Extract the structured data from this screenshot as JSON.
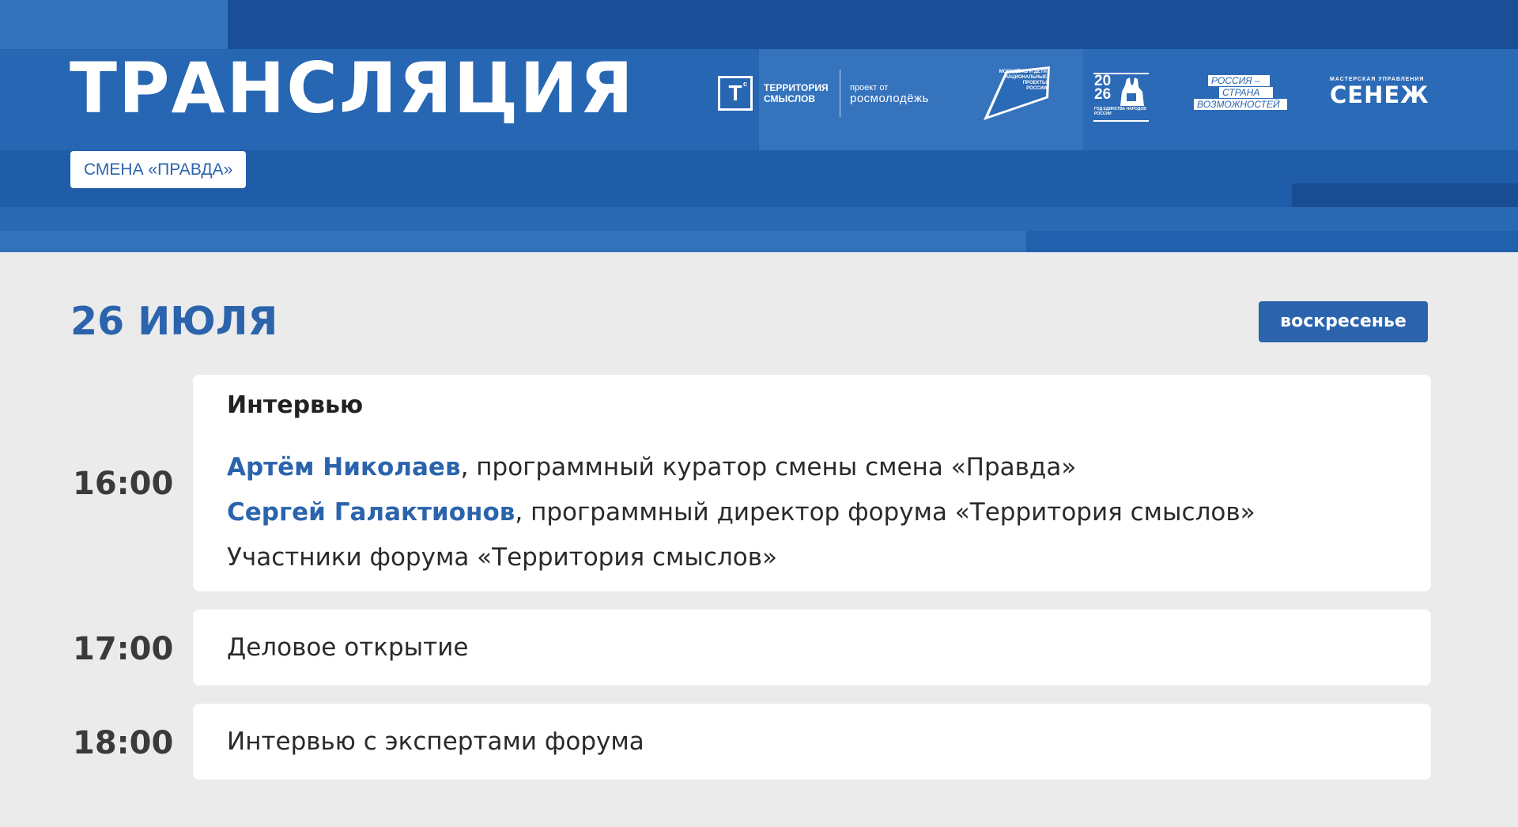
{
  "header": {
    "title": "ТРАНСЛЯЦИЯ",
    "shift_badge": "СМЕНА «ПРАВДА»",
    "logos": {
      "ts_mark": "Т",
      "ts_line1": "ТЕРРИТОРИЯ",
      "ts_line2": "СМЫСЛОВ",
      "ts_project": "проект от",
      "ts_org": "росмолодёжь",
      "np_line1": "МОЛОДЁЖЬ И ДЕТИ",
      "np_line2": "НАЦИОНАЛЬНЫЕ",
      "np_line3": "ПРОЕКТЫ",
      "np_line4": "РОССИИ",
      "god_num1": "20",
      "god_num2": "26",
      "god_text": "ГОД ЕДИНСТВА НАРОДОВ РОССИИ",
      "rsv_line1": "РОССИЯ –",
      "rsv_line2": "СТРАНА",
      "rsv_line3": "ВОЗМОЖНОСТЕЙ",
      "senezh_small": "МАСТЕРСКАЯ УПРАВЛЕНИЯ",
      "senezh_big": "СЕНЕЖ"
    }
  },
  "day": {
    "date": "26 ИЮЛЯ",
    "weekday": "воскресенье"
  },
  "schedule": [
    {
      "time": "16:00",
      "title": "Интервью",
      "lines": [
        {
          "name": "Артём Николаев",
          "text": ", программный куратор смены смена «Правда»"
        },
        {
          "name": "Сергей Галактионов",
          "text": ", программный директор форума «Территория смыслов»"
        },
        {
          "name": "",
          "text": "Участники форума «Территория смыслов»"
        }
      ]
    },
    {
      "time": "17:00",
      "text": "Деловое открытие"
    },
    {
      "time": "18:00",
      "text": "Интервью с экспертами форума"
    }
  ],
  "colors": {
    "accent": "#2b64ad",
    "banner": "#1f5ba8",
    "background": "#ebebeb",
    "card": "#ffffff",
    "time_text": "#3a3a3a"
  }
}
